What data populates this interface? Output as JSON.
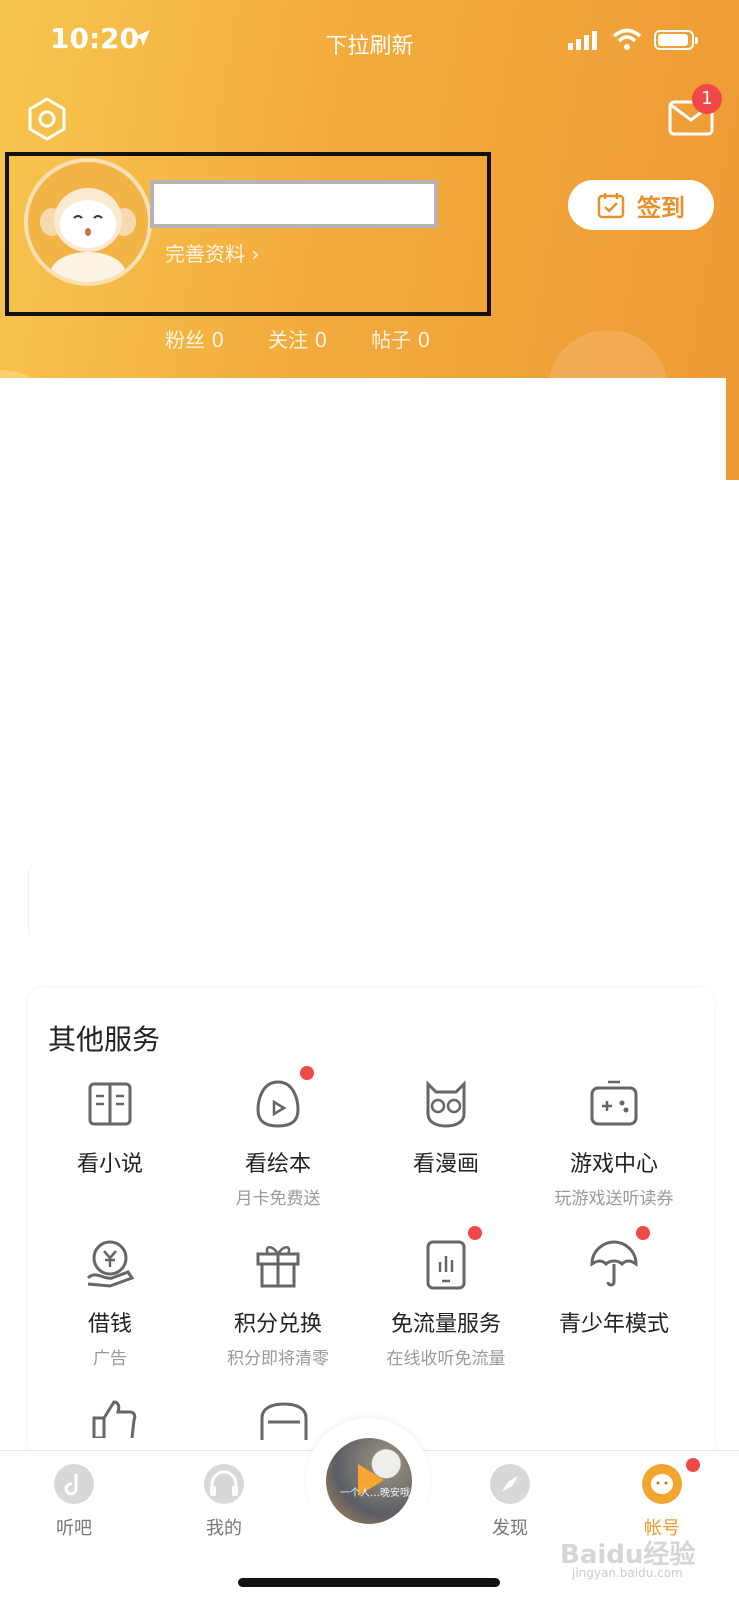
{
  "status_bar": {
    "time": "10:20",
    "pull_hint": "下拉刷新"
  },
  "header": {
    "mail_badge_count": "1",
    "edit_profile": "完善资料 ›",
    "checkin_label": "签到",
    "stats": [
      {
        "label": "粉丝",
        "value": "0"
      },
      {
        "label": "关注",
        "value": "0"
      },
      {
        "label": "帖子",
        "value": "0"
      }
    ],
    "accent_color": "#f3ab3b"
  },
  "services": {
    "title": "其他服务",
    "items": [
      {
        "label": "看小说",
        "sub": "",
        "icon": "book-icon",
        "dot": false
      },
      {
        "label": "看绘本",
        "sub": "月卡免费送",
        "icon": "picture-book-icon",
        "dot": true
      },
      {
        "label": "看漫画",
        "sub": "",
        "icon": "owl-icon",
        "dot": false
      },
      {
        "label": "游戏中心",
        "sub": "玩游戏送听读券",
        "icon": "gamepad-icon",
        "dot": false
      },
      {
        "label": "借钱",
        "sub": "广告",
        "icon": "loan-icon",
        "dot": false
      },
      {
        "label": "积分兑换",
        "sub": "积分即将清零",
        "icon": "gift-icon",
        "dot": false
      },
      {
        "label": "免流量服务",
        "sub": "在线收听免流量",
        "icon": "phone-chart-icon",
        "dot": true
      },
      {
        "label": "青少年模式",
        "sub": "",
        "icon": "umbrella-icon",
        "dot": true
      }
    ]
  },
  "tabbar": {
    "tabs": [
      {
        "label": "听吧",
        "icon": "music-note-icon"
      },
      {
        "label": "我的",
        "icon": "headphones-icon"
      },
      {
        "label": "发现",
        "icon": "compass-icon"
      },
      {
        "label": "帐号",
        "icon": "account-icon"
      }
    ],
    "player_title": "一个人…晚安哦",
    "active_color": "#eb9a2e"
  },
  "watermark": {
    "main": "Baidu经验",
    "sub": "jingyan.baidu.com"
  }
}
